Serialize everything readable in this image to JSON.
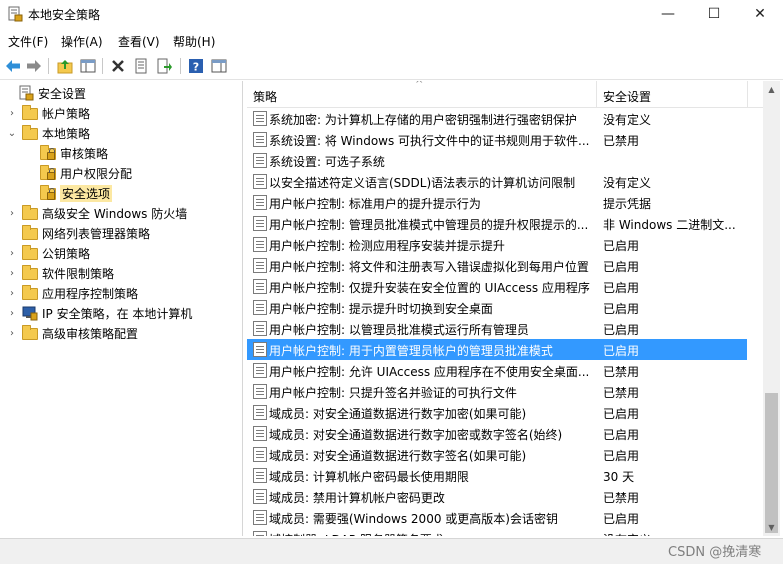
{
  "window": {
    "title": "本地安全策略",
    "min_glyph": "—",
    "max_glyph": "☐",
    "close_glyph": "✕"
  },
  "menu": [
    "文件(F)",
    "操作(A)",
    "查看(V)",
    "帮助(H)"
  ],
  "tree": [
    {
      "label": "安全设置",
      "expander": "",
      "icon": "security-settings-icon"
    },
    {
      "label": "帐户策略",
      "expander": "›",
      "icon": "folder-icon"
    },
    {
      "label": "本地策略",
      "expander": "⌄",
      "icon": "folder-icon"
    },
    {
      "label": "审核策略",
      "expander": "",
      "icon": "folder-lock-icon"
    },
    {
      "label": "用户权限分配",
      "expander": "",
      "icon": "folder-lock-icon"
    },
    {
      "label": "安全选项",
      "expander": "",
      "icon": "folder-lock-icon",
      "selected": true
    },
    {
      "label": "高级安全 Windows 防火墙",
      "expander": "›",
      "icon": "folder-icon"
    },
    {
      "label": "网络列表管理器策略",
      "expander": "",
      "icon": "folder-icon"
    },
    {
      "label": "公钥策略",
      "expander": "›",
      "icon": "folder-icon"
    },
    {
      "label": "软件限制策略",
      "expander": "›",
      "icon": "folder-icon"
    },
    {
      "label": "应用程序控制策略",
      "expander": "›",
      "icon": "folder-icon"
    },
    {
      "label": "IP 安全策略，在 本地计算机",
      "expander": "›",
      "icon": "ip-security-icon"
    },
    {
      "label": "高级审核策略配置",
      "expander": "›",
      "icon": "folder-icon"
    }
  ],
  "list": {
    "col_policy": "策略",
    "col_setting": "安全设置",
    "rows": [
      {
        "name": "系统加密: 为计算机上存储的用户密钥强制进行强密钥保护",
        "value": "没有定义"
      },
      {
        "name": "系统设置: 将 Windows 可执行文件中的证书规则用于软件...",
        "value": "已禁用"
      },
      {
        "name": "系统设置: 可选子系统",
        "value": ""
      },
      {
        "name": "以安全描述符定义语言(SDDL)语法表示的计算机访问限制",
        "value": "没有定义"
      },
      {
        "name": "用户帐户控制: 标准用户的提升提示行为",
        "value": "提示凭据"
      },
      {
        "name": "用户帐户控制: 管理员批准模式中管理员的提升权限提示的...",
        "value": "非 Windows 二进制文..."
      },
      {
        "name": "用户帐户控制: 检测应用程序安装并提示提升",
        "value": "已启用"
      },
      {
        "name": "用户帐户控制: 将文件和注册表写入错误虚拟化到每用户位置",
        "value": "已启用"
      },
      {
        "name": "用户帐户控制: 仅提升安装在安全位置的 UIAccess 应用程序",
        "value": "已启用"
      },
      {
        "name": "用户帐户控制: 提示提升时切换到安全桌面",
        "value": "已启用"
      },
      {
        "name": "用户帐户控制: 以管理员批准模式运行所有管理员",
        "value": "已启用"
      },
      {
        "name": "用户帐户控制: 用于内置管理员帐户的管理员批准模式",
        "value": "已启用",
        "selected": true
      },
      {
        "name": "用户帐户控制: 允许 UIAccess 应用程序在不使用安全桌面...",
        "value": "已禁用"
      },
      {
        "name": "用户帐户控制: 只提升签名并验证的可执行文件",
        "value": "已禁用"
      },
      {
        "name": "域成员: 对安全通道数据进行数字加密(如果可能)",
        "value": "已启用"
      },
      {
        "name": "域成员: 对安全通道数据进行数字加密或数字签名(始终)",
        "value": "已启用"
      },
      {
        "name": "域成员: 对安全通道数据进行数字签名(如果可能)",
        "value": "已启用"
      },
      {
        "name": "域成员: 计算机帐户密码最长使用期限",
        "value": "30 天"
      },
      {
        "name": "域成员: 禁用计算机帐户密码更改",
        "value": "已禁用"
      },
      {
        "name": "域成员: 需要强(Windows 2000 或更高版本)会话密钥",
        "value": "已启用"
      },
      {
        "name": "域控制器: LDAP 服务器签名要求",
        "value": "没有定义"
      }
    ]
  },
  "watermark": "CSDN @挽清寒"
}
